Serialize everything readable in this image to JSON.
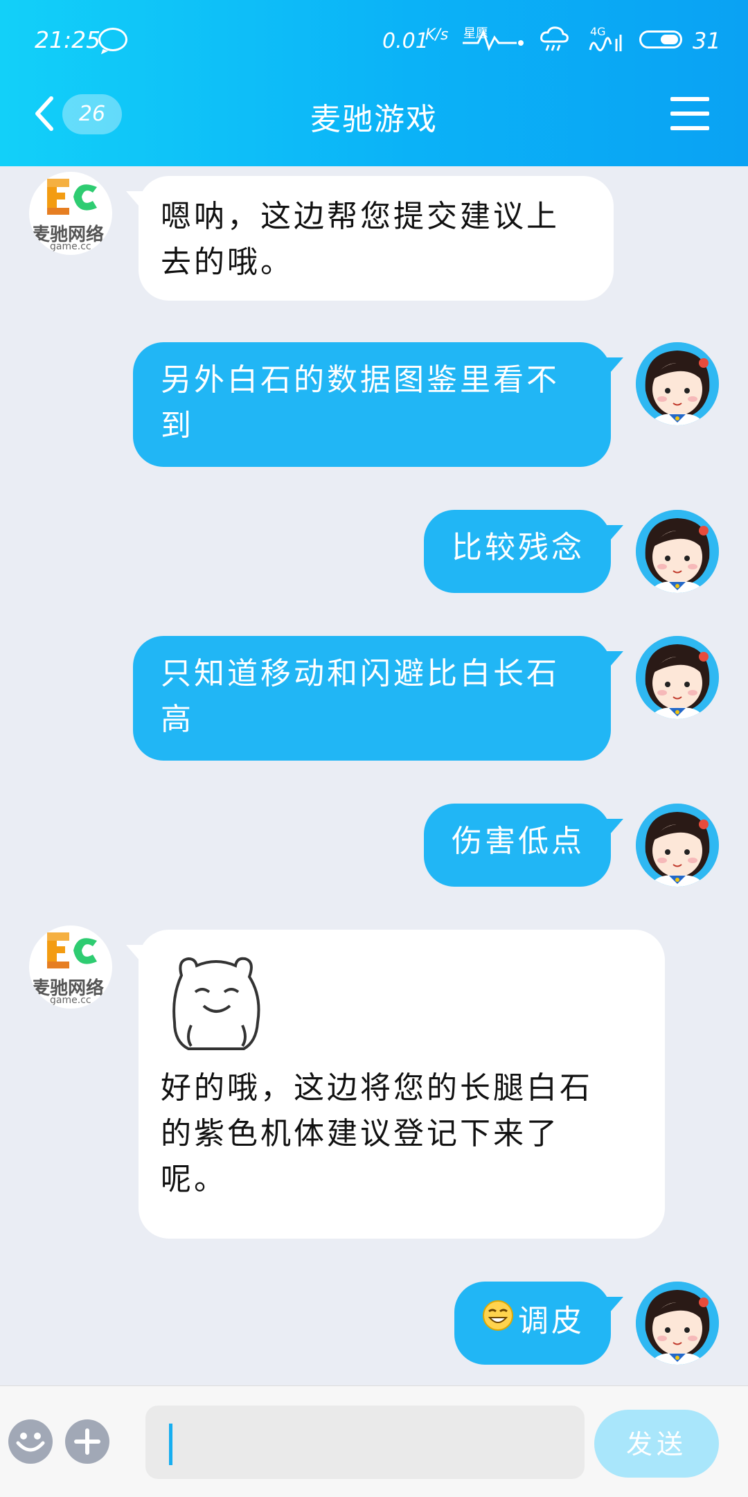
{
  "status_bar": {
    "time": "21:25",
    "net_speed_value": "0.01",
    "net_speed_unit": "K/s",
    "hr_label": "星愿",
    "network_label": "4G",
    "battery_level": 0.31,
    "battery_text": "31"
  },
  "nav": {
    "unread_count": "26",
    "title": "麦驰游戏"
  },
  "messages": [
    {
      "side": "in",
      "sender": "company",
      "text_lines": [
        "嗯呐，这边帮您提交建议上",
        "去的哦。"
      ]
    },
    {
      "side": "out",
      "sender": "user",
      "text_lines": [
        "另外白石的数据图鉴里看不",
        "到"
      ]
    },
    {
      "side": "out",
      "sender": "user",
      "text_lines": [
        "比较残念"
      ]
    },
    {
      "side": "out",
      "sender": "user",
      "text_lines": [
        "只知道移动和闪避比白长石",
        "高"
      ]
    },
    {
      "side": "out",
      "sender": "user",
      "text_lines": [
        "伤害低点"
      ]
    },
    {
      "side": "in",
      "sender": "company",
      "sticker": "bear-smirk-sticker",
      "text_lines": [
        "好的哦，这边将您的长腿白石",
        "的紫色机体建议登记下来了",
        "呢。"
      ]
    },
    {
      "side": "out",
      "sender": "user",
      "emoji": "grin-emoji",
      "text_lines": [
        "调皮"
      ]
    }
  ],
  "company_logo": {
    "text": "麦驰网络",
    "sub": "game.cc"
  },
  "input": {
    "placeholder": "",
    "value": "",
    "send_label": "发送"
  },
  "colors": {
    "header_start": "#12d0f9",
    "header_end": "#0aa2f3",
    "bubble_out": "#21b6f5",
    "bubble_in": "#ffffff",
    "chat_bg": "#eaedf4",
    "send_disabled": "#a9e6fb"
  }
}
